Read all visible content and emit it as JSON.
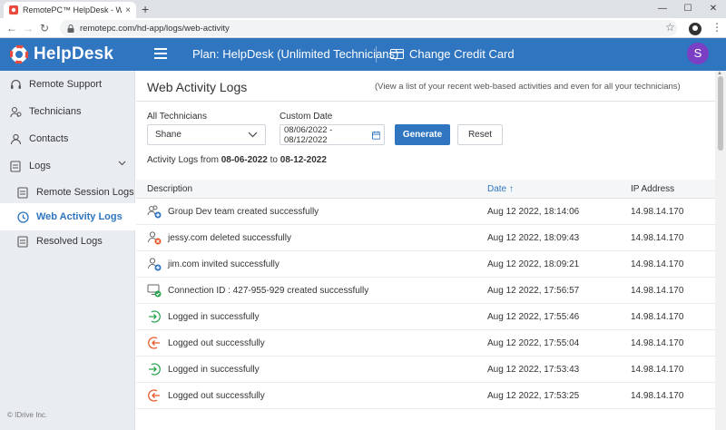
{
  "browser": {
    "tab_title": "RemotePC™ HelpDesk - Web Ac",
    "tab_close": "×",
    "new_tab": "+",
    "url": "remotepc.com/hd-app/logs/web-activity",
    "minimize": "—",
    "maximize": "☐",
    "close": "✕"
  },
  "header": {
    "logo_text": "HelpDesk",
    "plan": "Plan: HelpDesk (Unlimited Technicians)",
    "change_card": "Change Credit Card",
    "avatar_initial": "S"
  },
  "sidebar": {
    "items": [
      {
        "label": "Remote Support",
        "icon": "headset-icon"
      },
      {
        "label": "Technicians",
        "icon": "technicians-icon"
      },
      {
        "label": "Contacts",
        "icon": "contact-icon"
      },
      {
        "label": "Logs",
        "icon": "document-icon"
      },
      {
        "label": "Remote Session Logs",
        "icon": "document-icon"
      },
      {
        "label": "Web Activity Logs",
        "icon": "clock-icon"
      },
      {
        "label": "Resolved Logs",
        "icon": "document-icon"
      }
    ],
    "copyright": "© IDrive Inc."
  },
  "page": {
    "title": "Web Activity Logs",
    "subtitle": "(View a list of your recent web-based activities and even for all your technicians)",
    "technicians_label": "All Technicians",
    "technician_value": "Shane",
    "custom_date_label": "Custom Date",
    "date_value": "08/06/2022 - 08/12/2022",
    "generate": "Generate",
    "reset": "Reset",
    "range_prefix": "Activity Logs from",
    "range_from": "08-06-2022",
    "range_to_word": "to",
    "range_to": "08-12-2022"
  },
  "table": {
    "columns": {
      "description": "Description",
      "date": "Date",
      "ip": "IP Address"
    },
    "sort_indicator": "↑",
    "rows": [
      {
        "icon": "group-add-icon",
        "description": "Group Dev team created successfully",
        "date": "Aug 12 2022, 18:14:06",
        "ip": "14.98.14.170"
      },
      {
        "icon": "user-delete-icon",
        "description": "jessy.com deleted successfully",
        "date": "Aug 12 2022, 18:09:43",
        "ip": "14.98.14.170"
      },
      {
        "icon": "user-invite-icon",
        "description": "jim.com invited successfully",
        "date": "Aug 12 2022, 18:09:21",
        "ip": "14.98.14.170"
      },
      {
        "icon": "computer-check-icon",
        "description": "Connection ID : 427-955-929 created successfully",
        "date": "Aug 12 2022, 17:56:57",
        "ip": "14.98.14.170"
      },
      {
        "icon": "login-icon",
        "description": "Logged in successfully",
        "date": "Aug 12 2022, 17:55:46",
        "ip": "14.98.14.170"
      },
      {
        "icon": "logout-icon",
        "description": "Logged out successfully",
        "date": "Aug 12 2022, 17:55:04",
        "ip": "14.98.14.170"
      },
      {
        "icon": "login-icon",
        "description": "Logged in successfully",
        "date": "Aug 12 2022, 17:53:43",
        "ip": "14.98.14.170"
      },
      {
        "icon": "logout-icon",
        "description": "Logged out successfully",
        "date": "Aug 12 2022, 17:53:25",
        "ip": "14.98.14.170"
      }
    ]
  },
  "colors": {
    "brand_blue": "#2f75c0",
    "avatar_purple": "#7b3fc4",
    "success_green": "#2aa44f",
    "danger_orange": "#e8552a"
  }
}
